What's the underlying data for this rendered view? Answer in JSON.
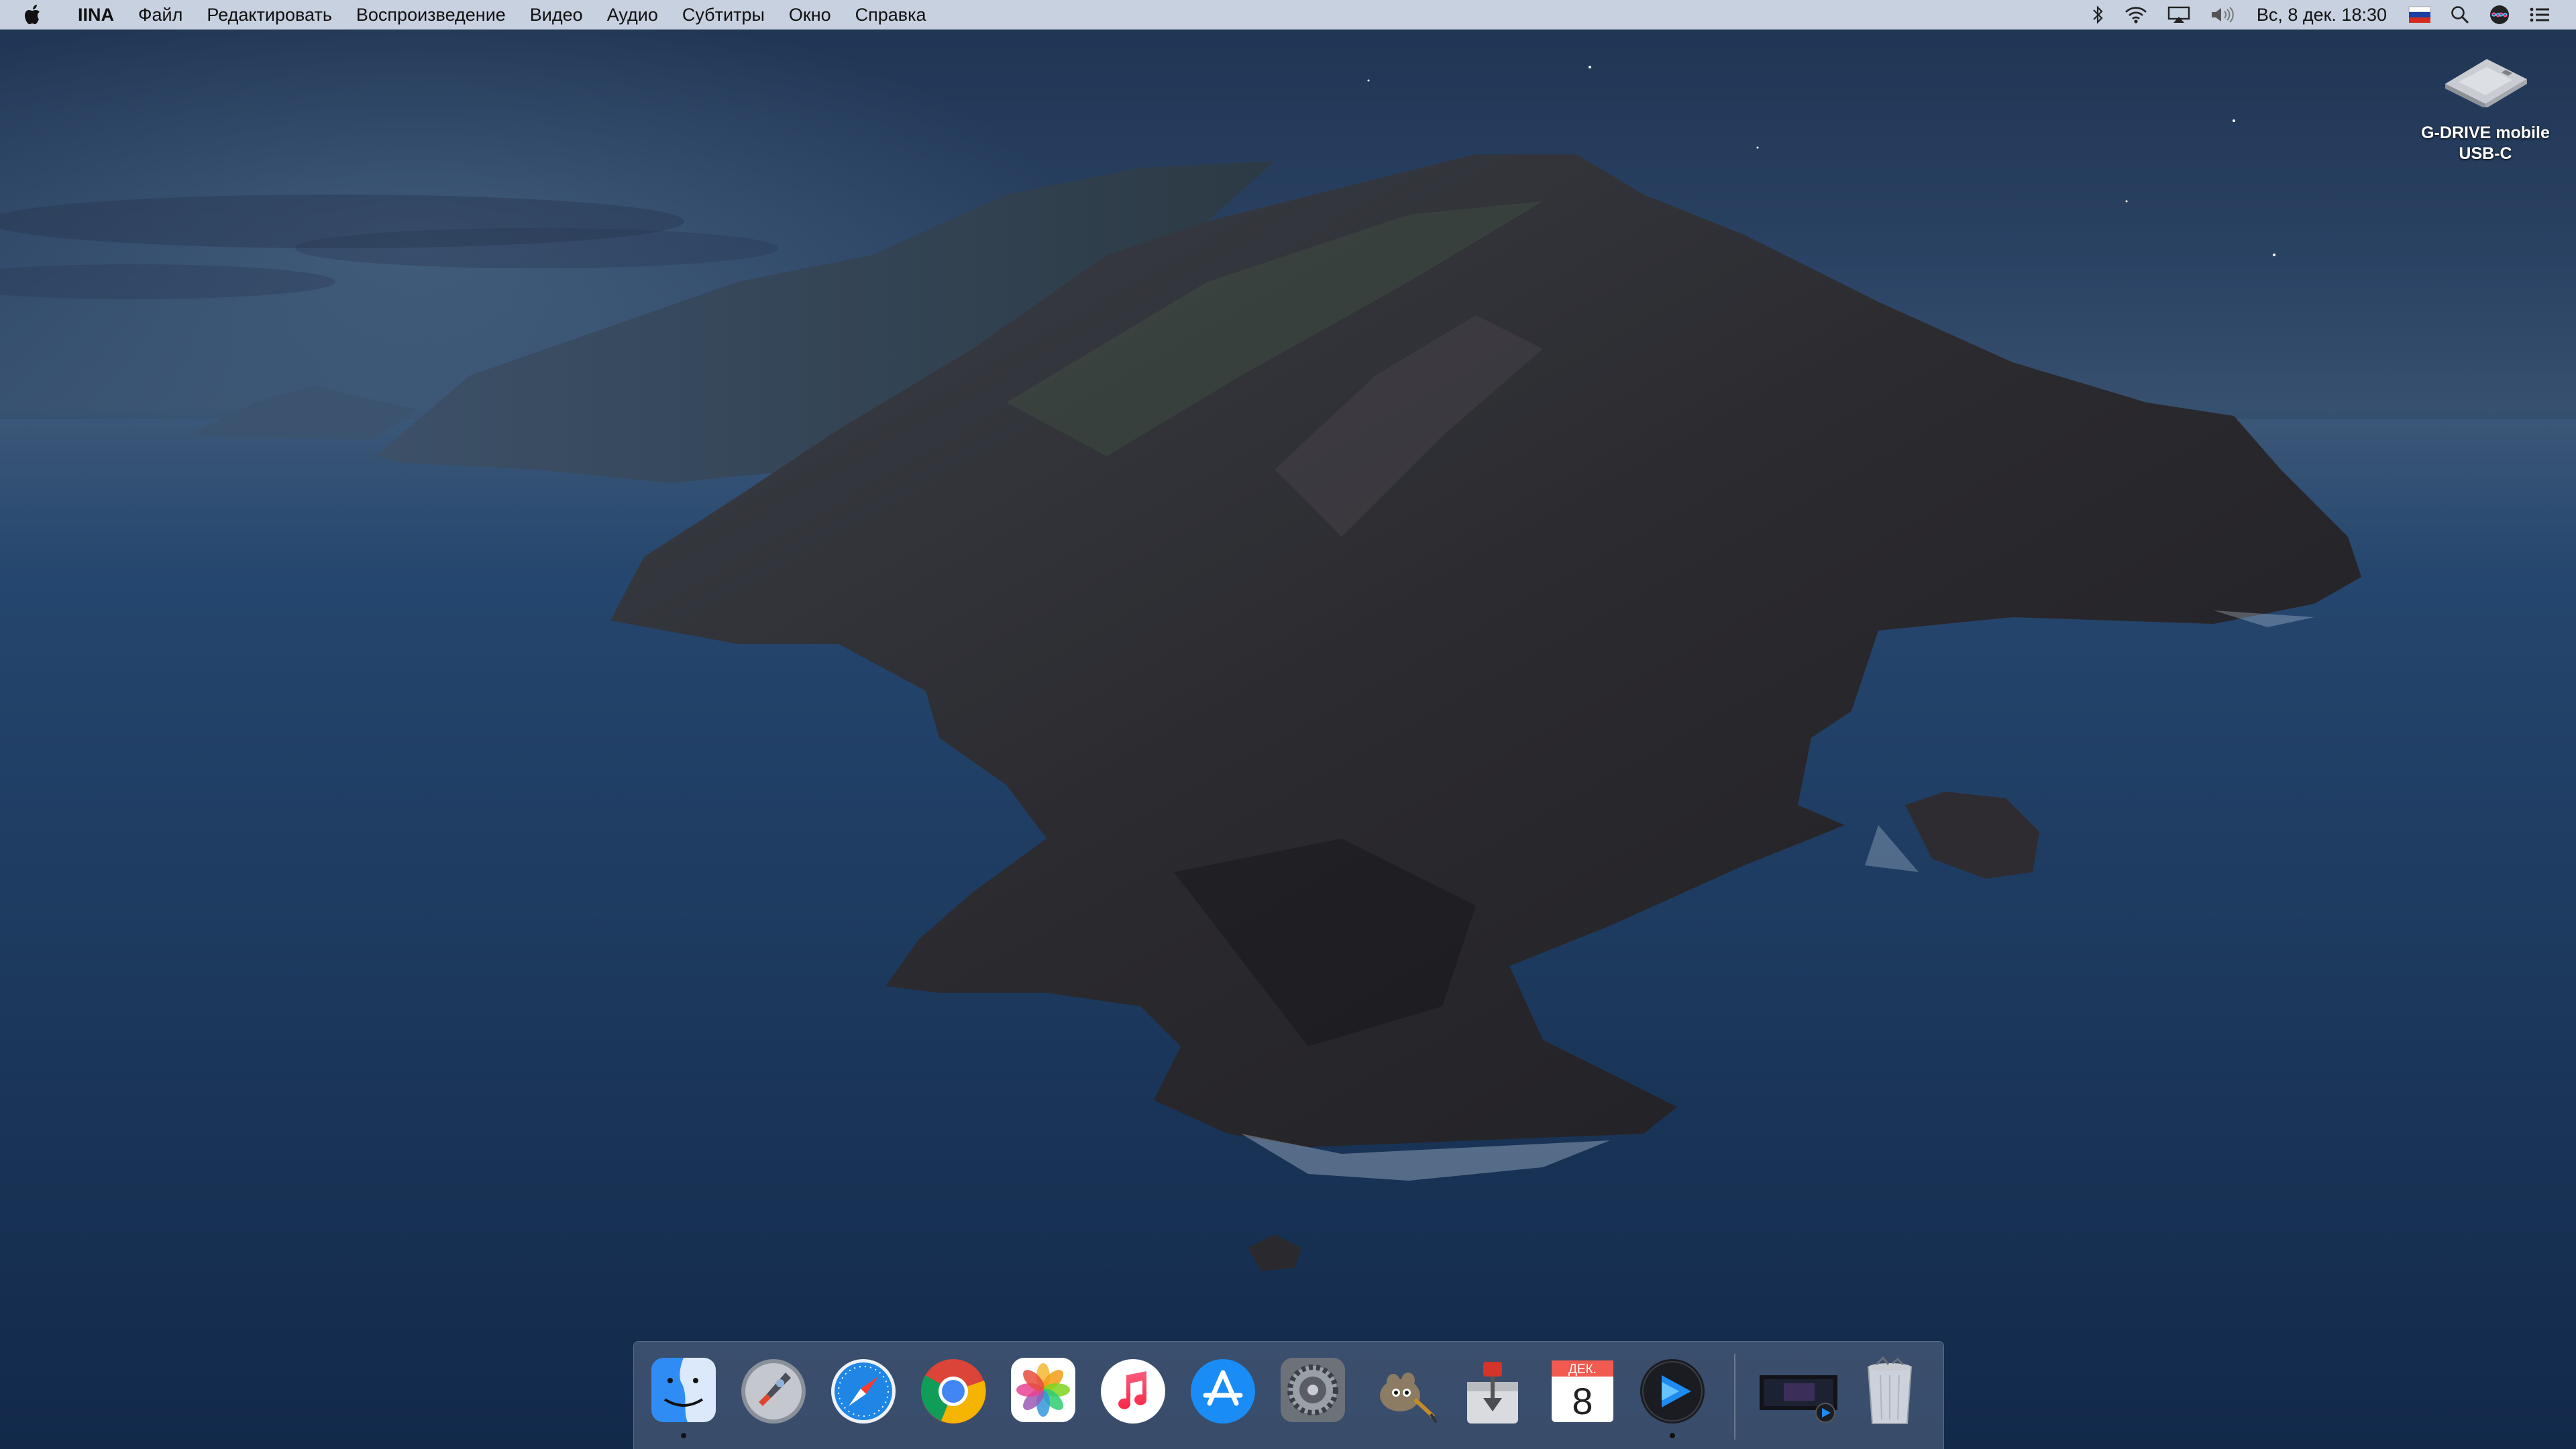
{
  "menubar": {
    "apple_icon": "apple-logo-icon",
    "app_name": "IINA",
    "menus": [
      "Файл",
      "Редактировать",
      "Воспроизведение",
      "Видео",
      "Аудио",
      "Субтитры",
      "Окно",
      "Справка"
    ],
    "status_icons": [
      "bluetooth-icon",
      "wifi-icon",
      "airplay-icon",
      "volume-icon"
    ],
    "clock": "Вс, 8 дек.  18:30",
    "right_icons": [
      "russian-flag-input-icon",
      "spotlight-search-icon",
      "siri-icon",
      "notification-center-icon"
    ]
  },
  "desktop": {
    "drive_label": "G-DRIVE mobile USB-C"
  },
  "dock": {
    "apps": [
      {
        "name": "Finder",
        "icon": "finder-icon",
        "running": true
      },
      {
        "name": "Launchpad",
        "icon": "launchpad-icon",
        "running": false
      },
      {
        "name": "Safari",
        "icon": "safari-icon",
        "running": false
      },
      {
        "name": "Google Chrome",
        "icon": "chrome-icon",
        "running": false
      },
      {
        "name": "Photos",
        "icon": "photos-icon",
        "running": false
      },
      {
        "name": "Music",
        "icon": "music-icon",
        "running": false
      },
      {
        "name": "App Store",
        "icon": "app-store-icon",
        "running": false
      },
      {
        "name": "System Preferences",
        "icon": "system-preferences-icon",
        "running": false
      },
      {
        "name": "GIMP",
        "icon": "gimp-icon",
        "running": false
      },
      {
        "name": "Transmission",
        "icon": "transmission-icon",
        "running": false
      },
      {
        "name": "Calendar",
        "icon": "calendar-icon",
        "running": false
      },
      {
        "name": "IINA",
        "icon": "iina-icon",
        "running": true
      }
    ],
    "calendar": {
      "month": "ДЕК.",
      "day": "8"
    },
    "others": [
      {
        "name": "Minimized window",
        "icon": "minimized-window-icon"
      },
      {
        "name": "Trash",
        "icon": "trash-icon"
      }
    ]
  },
  "colors": {
    "menubar_bg": "#d6deeb",
    "ocean": "#1c3a62",
    "sky": "#2a4263",
    "island": "#2e2d31"
  }
}
